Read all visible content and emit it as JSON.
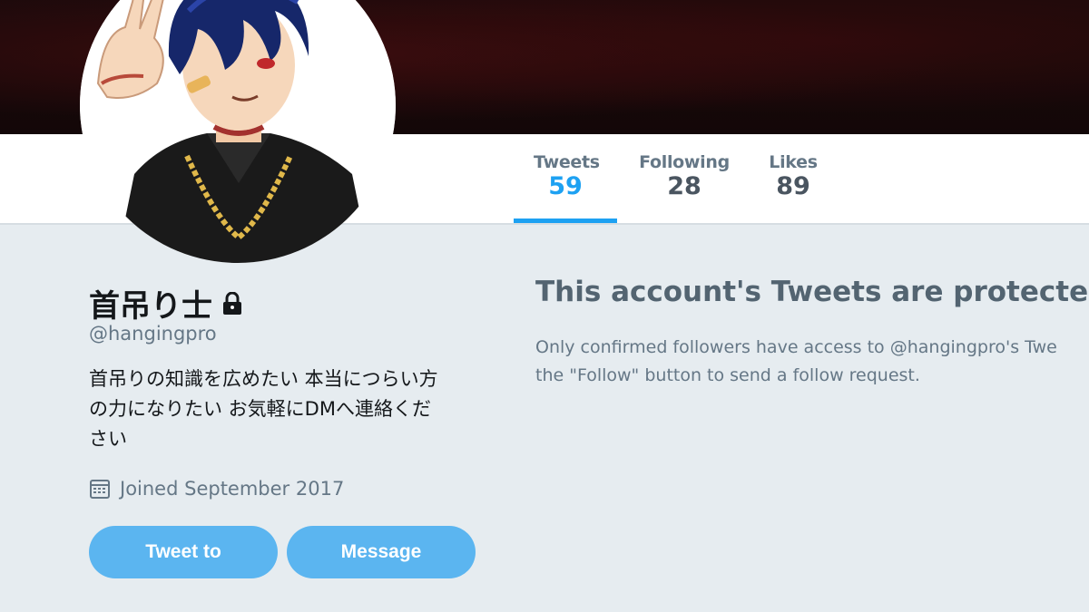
{
  "profile": {
    "name": "首吊り士",
    "handle": "@hangingpro",
    "bio": "首吊りの知識を広めたい 本当につらい方\nの力になりたい お気軽にDMへ連絡くだ\nさい",
    "joined": "Joined September 2017"
  },
  "stats": [
    {
      "label": "Tweets",
      "value": "59",
      "active": true
    },
    {
      "label": "Following",
      "value": "28",
      "active": false
    },
    {
      "label": "Likes",
      "value": "89",
      "active": false
    }
  ],
  "buttons": {
    "tweet_to": "Tweet to",
    "message": "Message"
  },
  "protected": {
    "title": "This account's Tweets are protected.",
    "line1": "Only confirmed followers have access to @hangingpro's Twe",
    "line2": "the \"Follow\" button to send a follow request."
  },
  "colors": {
    "accent": "#1da1f2",
    "button": "#5bb5f0",
    "background": "#e6ecf0",
    "banner": "#1c0a0b"
  },
  "icons": {
    "lock": "lock-icon",
    "calendar": "calendar-icon"
  }
}
